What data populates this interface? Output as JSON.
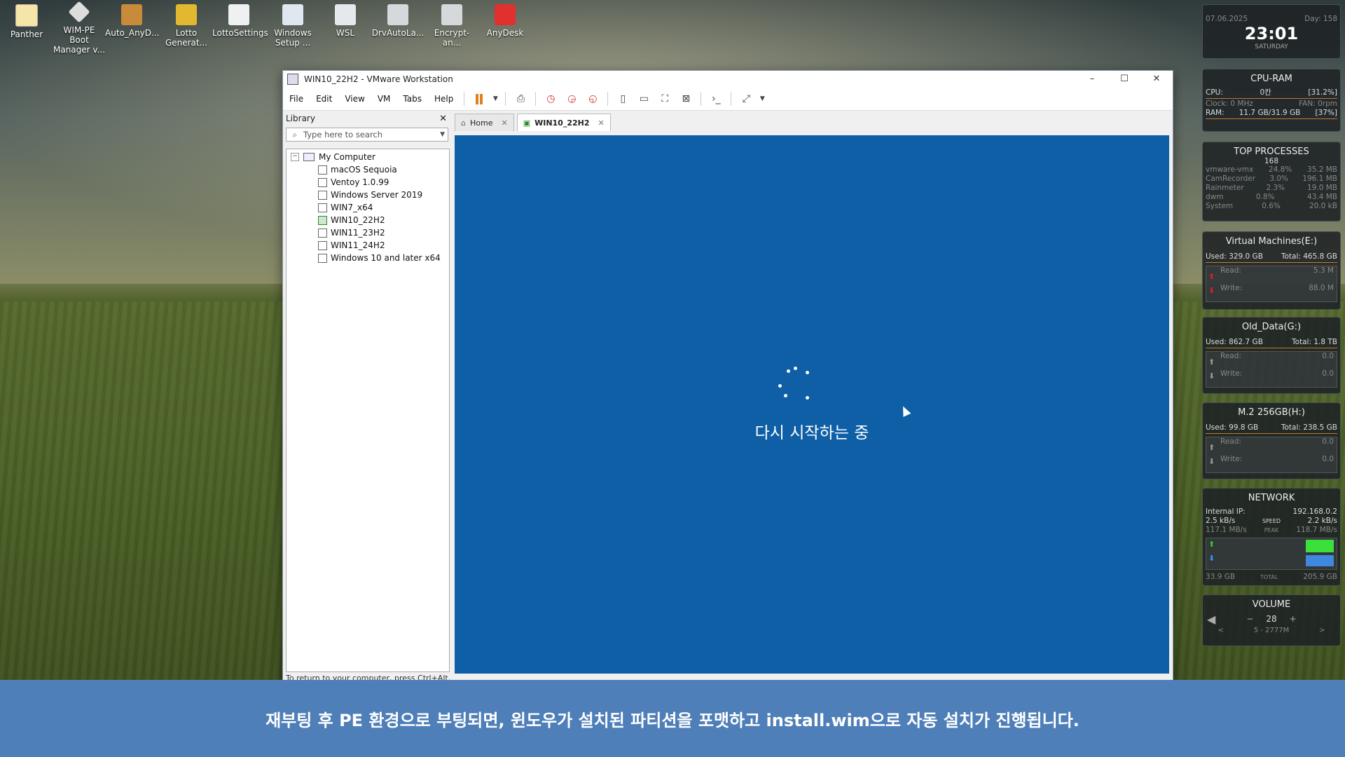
{
  "desktop": {
    "icons": [
      {
        "label": "Panther"
      },
      {
        "label": "WIM-PE Boot Manager v..."
      },
      {
        "label": "Auto_AnyD..."
      },
      {
        "label": "Lotto Generat..."
      },
      {
        "label": "LottoSettings"
      },
      {
        "label": "Windows Setup ..."
      },
      {
        "label": "WSL"
      },
      {
        "label": "DrvAutoLa..."
      },
      {
        "label": "Encrypt-an..."
      },
      {
        "label": "AnyDesk"
      }
    ]
  },
  "window": {
    "title": "WIN10_22H2 - VMware Workstation",
    "min": "–",
    "max": "☐",
    "close": "✕"
  },
  "menu": [
    "File",
    "Edit",
    "View",
    "VM",
    "Tabs",
    "Help"
  ],
  "library": {
    "header": "Library",
    "close": "✕",
    "search_placeholder": "Type here to search",
    "root": "My Computer",
    "vms": [
      "macOS Sequoia",
      "Ventoy 1.0.99",
      "Windows Server 2019",
      "WIN7_x64",
      "WIN10_22H2",
      "WIN11_23H2",
      "WIN11_24H2",
      "Windows 10 and later x64"
    ]
  },
  "tabs": [
    {
      "label": "Home"
    },
    {
      "label": "WIN10_22H2"
    }
  ],
  "vm_screen": {
    "status_text": "다시 시작하는 중",
    "color": "#0e5fa6"
  },
  "statusbar": "To return to your computer, press Ctrl+Alt.",
  "gadgets": {
    "clock": {
      "date": "07.06.2025",
      "day": "Day: 158",
      "time": "23:01",
      "weekday": "SATURDAY"
    },
    "cpu_ram": {
      "title": "CPU-RAM",
      "cpu_label": "CPU:",
      "cpu_value": "0칸",
      "cpu_pct": "[31.2%]",
      "clock": "Clock: 0 MHz",
      "fan": "FAN: 0rpm",
      "ram_label": "RAM:",
      "ram_value": "11.7 GB/31.9 GB",
      "ram_pct": "[37%]"
    },
    "top": {
      "title": "TOP PROCESSES",
      "count": "168",
      "rows": [
        {
          "name": "vmware-vmx",
          "cpu": "24.8%",
          "mem": "35.2 MB"
        },
        {
          "name": "CamRecorder",
          "cpu": "3.0%",
          "mem": "196.1 MB"
        },
        {
          "name": "Rainmeter",
          "cpu": "2.3%",
          "mem": "19.0 MB"
        },
        {
          "name": "dwm",
          "cpu": "0.8%",
          "mem": "43.4 MB"
        },
        {
          "name": "System",
          "cpu": "0.6%",
          "mem": "20.0 kB"
        }
      ]
    },
    "disks": [
      {
        "title": "Virtual Machines(E:)",
        "used": "Used: 329.0 GB",
        "total": "Total: 465.8 GB",
        "read": "Read:",
        "read_v": "5.3 M",
        "write": "Write:",
        "write_v": "88.0 M"
      },
      {
        "title": "Old_Data(G:)",
        "used": "Used: 862.7 GB",
        "total": "Total: 1.8 TB",
        "read": "Read:",
        "read_v": "0.0",
        "write": "Write:",
        "write_v": "0.0"
      },
      {
        "title": "M.2 256GB(H:)",
        "used": "Used: 99.8 GB",
        "total": "Total: 238.5 GB",
        "read": "Read:",
        "read_v": "0.0",
        "write": "Write:",
        "write_v": "0.0"
      }
    ],
    "network": {
      "title": "NETWORK",
      "ip_label": "Internal IP:",
      "ip": "192.168.0.2",
      "up": "2.5 kB/s",
      "speed": "SPEED",
      "down": "2.2 kB/s",
      "up_peak": "117.1 MB/s",
      "peak": "PEAK",
      "down_peak": "118.7 MB/s",
      "up_total": "33.9 GB",
      "total": "TOTAL",
      "down_total": "205.9 GB"
    },
    "volume": {
      "title": "VOLUME",
      "value": "28",
      "minus": "−",
      "plus": "+",
      "device": "5 - 2777M",
      "prev": "<",
      "next": ">"
    }
  },
  "subtitle": "재부팅 후 PE 환경으로 부팅되면, 윈도우가 설치된 파티션을 포맷하고 install.wim으로 자동 설치가 진행됩니다."
}
